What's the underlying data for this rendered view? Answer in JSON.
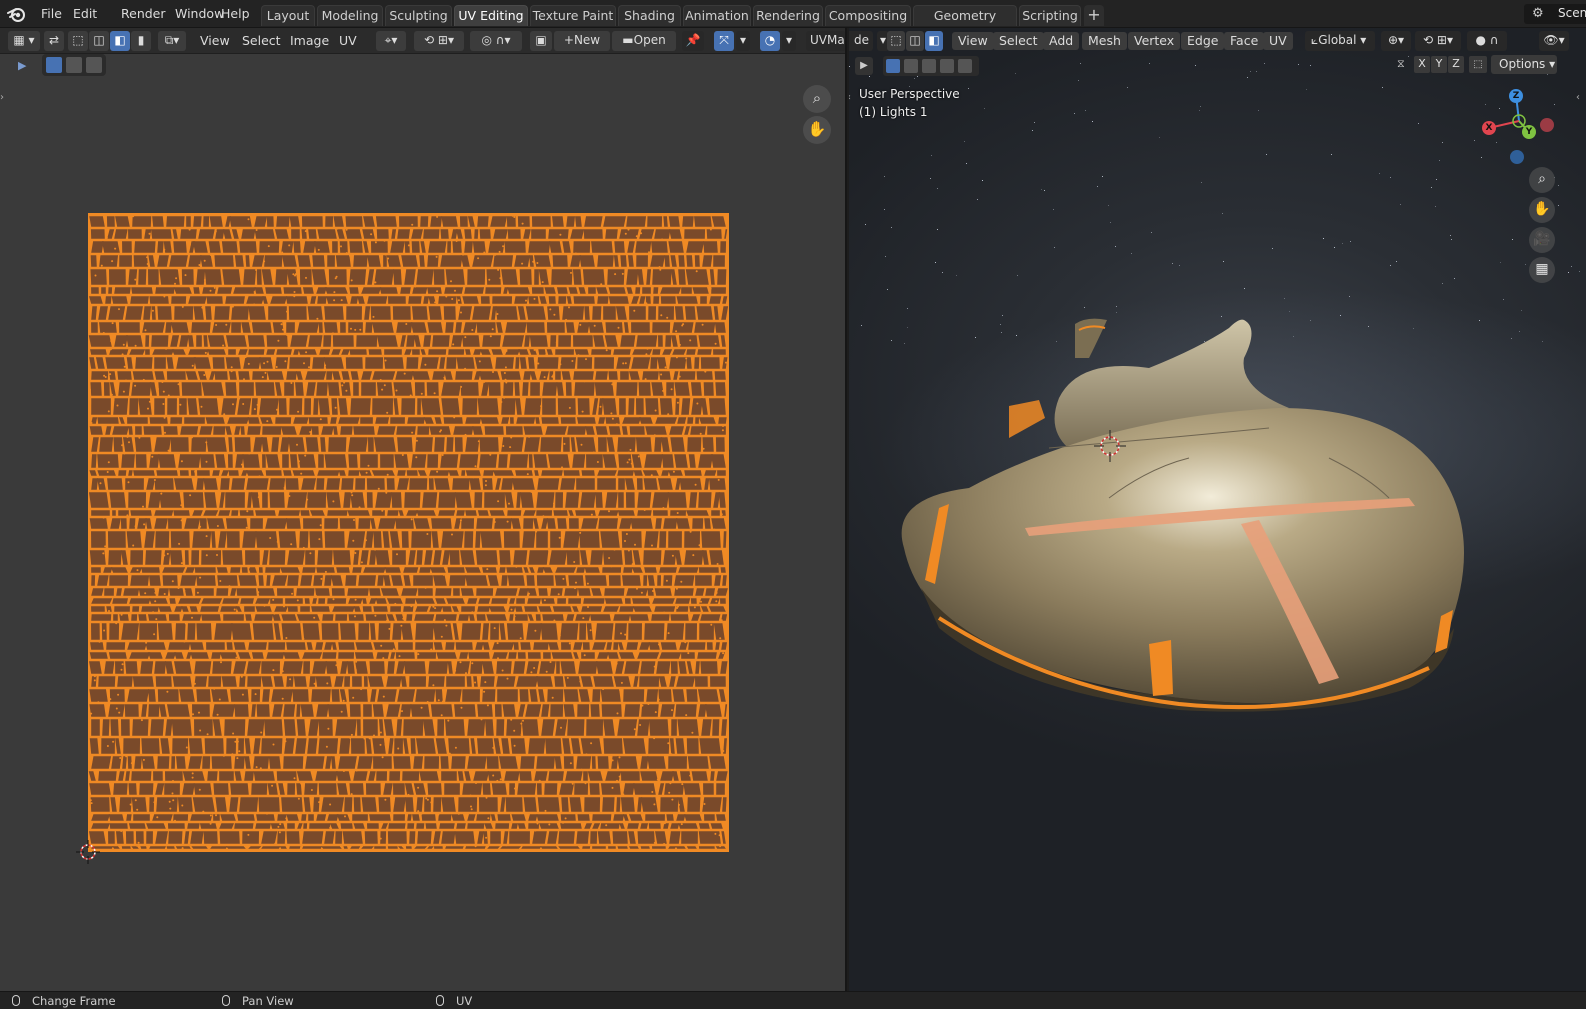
{
  "topbar": {
    "menus": [
      "File",
      "Edit",
      "Render",
      "Window",
      "Help"
    ],
    "workspaces": [
      "Layout",
      "Modeling",
      "Sculpting",
      "UV Editing",
      "Texture Paint",
      "Shading",
      "Animation",
      "Rendering",
      "Compositing",
      "Geometry Nodes",
      "Scripting"
    ],
    "active_workspace": "UV Editing",
    "add_tab": "+",
    "scene_label": "Scen"
  },
  "uv_editor": {
    "menus": [
      "View",
      "Select",
      "Image",
      "UV"
    ],
    "new_label": "New",
    "open_label": "Open",
    "uvmap_label": "UVMa"
  },
  "viewport": {
    "mode_label": "de",
    "menus": [
      "View",
      "Select",
      "Add",
      "Mesh",
      "Vertex",
      "Edge",
      "Face",
      "UV"
    ],
    "orientation_label": "Global",
    "options_label": "Options",
    "axis_buttons": [
      "X",
      "Y",
      "Z"
    ],
    "perspective_label": "User Perspective",
    "object_label": "(1) Lights 1",
    "gizmo": {
      "x": "X",
      "y": "Y",
      "z": "Z"
    }
  },
  "statusbar": {
    "items": [
      "Change Frame",
      "Pan View",
      "UV"
    ]
  },
  "colors": {
    "accent_orange": "#f08a24",
    "uv_face_fill": "#7a4a2a",
    "active_blue": "#4772b3",
    "gizmo_x": "#e0454f",
    "gizmo_y": "#7fc241",
    "gizmo_z": "#3d8fe0"
  },
  "icons": [
    "blender-logo-icon",
    "editor-type-icon",
    "sync-selection-icon",
    "vertex-select-icon",
    "edge-select-icon",
    "face-select-icon",
    "island-select-icon",
    "sticky-select-icon",
    "pivot-icon",
    "snap-icon",
    "proportional-icon",
    "image-browse-icon",
    "pin-icon",
    "overlay-icon",
    "gizmo-icon",
    "zoom-icon",
    "hand-pan-icon",
    "camera-icon",
    "grid-ortho-icon",
    "mouse-icon",
    "2d-cursor-icon",
    "3d-cursor-icon"
  ]
}
